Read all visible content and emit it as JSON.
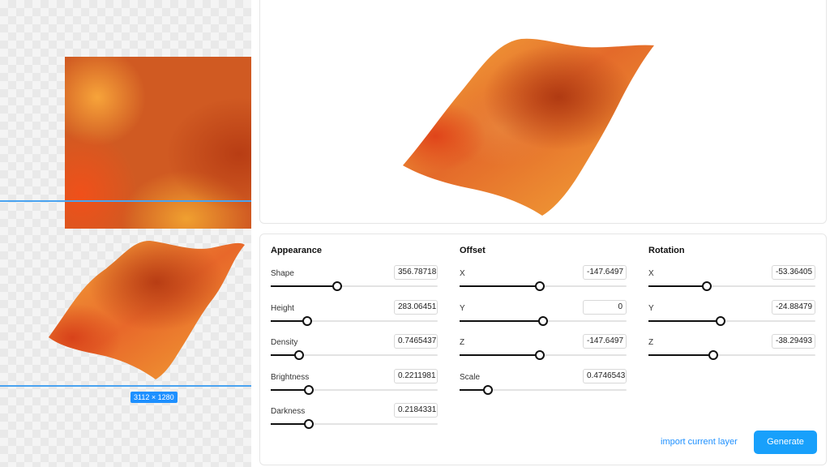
{
  "canvas": {
    "size_badge": "3112 × 1280"
  },
  "colors": {
    "accent": "#18a0fb",
    "surface_dark": "#b83d14",
    "surface_orange": "#e8682a",
    "surface_yellow": "#f4a83a"
  },
  "controls": {
    "sections": [
      {
        "title": "Appearance",
        "items": [
          {
            "label": "Shape",
            "value": "356.78718",
            "level": 0.4
          },
          {
            "label": "Height",
            "value": "283.06451",
            "level": 0.22
          },
          {
            "label": "Density",
            "value": "0.7465437",
            "level": 0.17
          },
          {
            "label": "Brightness",
            "value": "0.2211981",
            "level": 0.23
          },
          {
            "label": "Darkness",
            "value": "0.2184331",
            "level": 0.23
          }
        ]
      },
      {
        "title": "Offset",
        "items": [
          {
            "label": "X",
            "value": "-147.6497",
            "level": 0.48
          },
          {
            "label": "Y",
            "value": "0",
            "level": 0.5
          },
          {
            "label": "Z",
            "value": "-147.6497",
            "level": 0.48
          },
          {
            "label": "Scale",
            "value": "0.4746543",
            "level": 0.17
          }
        ]
      },
      {
        "title": "Rotation",
        "items": [
          {
            "label": "X",
            "value": "-53.36405",
            "level": 0.35
          },
          {
            "label": "Y",
            "value": "-24.88479",
            "level": 0.43
          },
          {
            "label": "Z",
            "value": "-38.29493",
            "level": 0.39
          }
        ]
      }
    ],
    "import_label": "import current layer",
    "generate_label": "Generate"
  }
}
